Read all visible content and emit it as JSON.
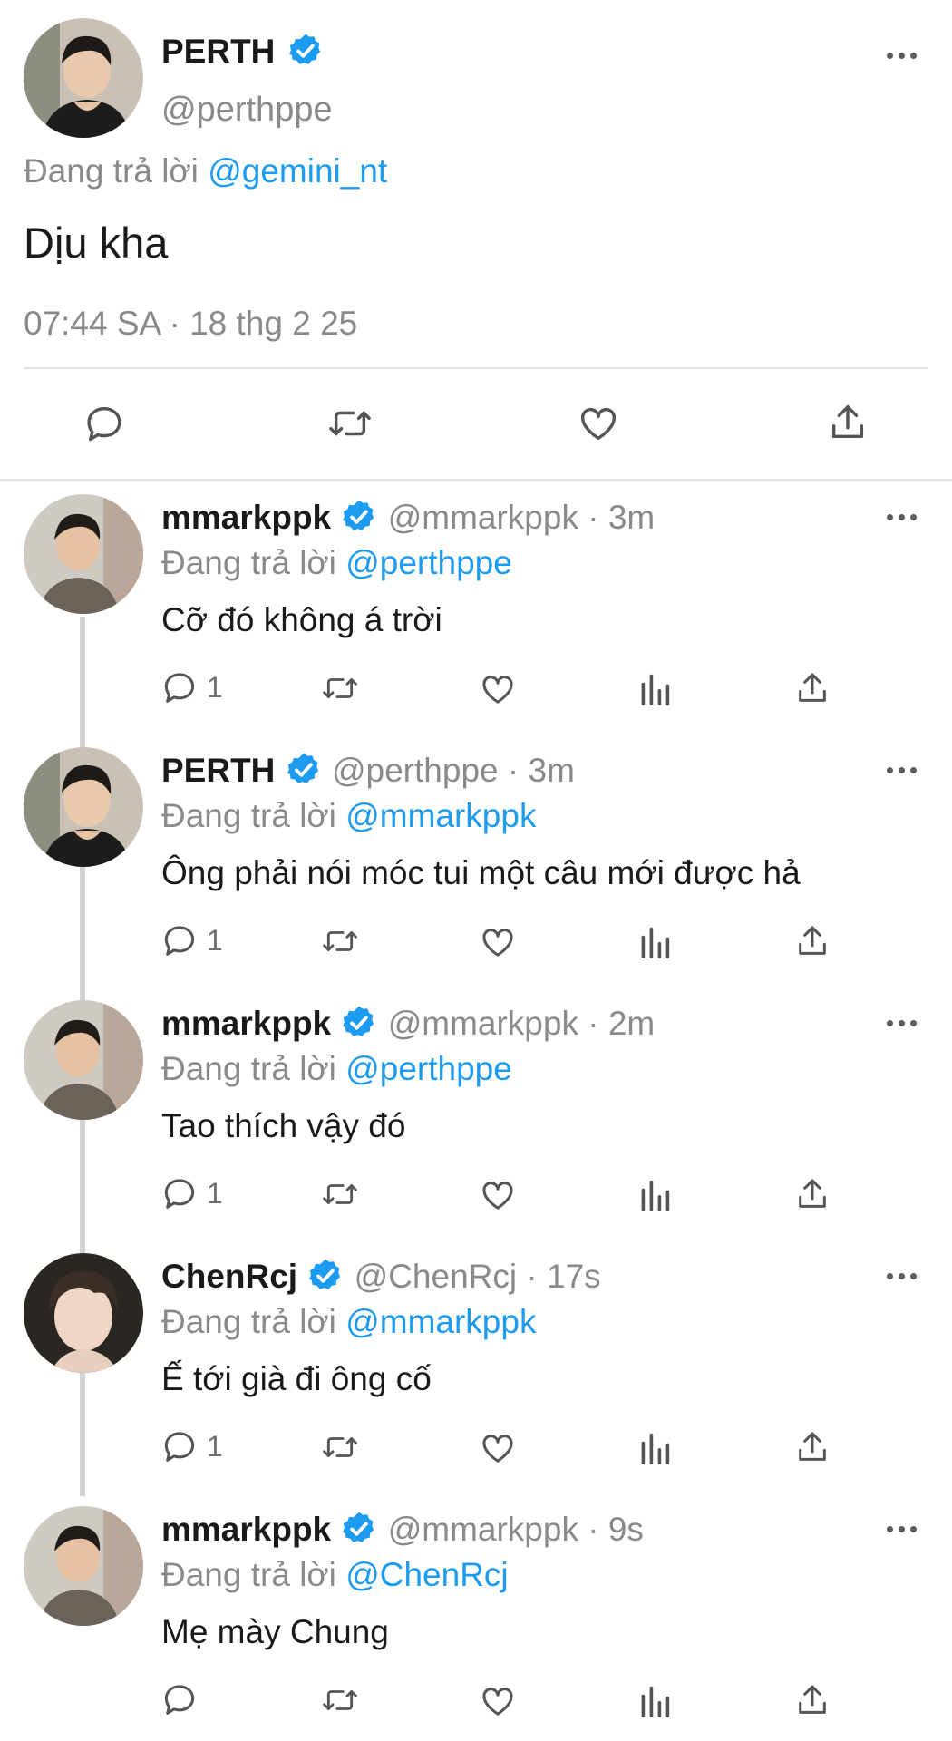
{
  "main_tweet": {
    "name": "PERTH",
    "handle": "@perthppe",
    "reply_prefix": "Đang trả lời",
    "reply_to": "@gemini_nt",
    "text": "Dịu kha",
    "timestamp": "07:44 SA · 18 thg 2 25"
  },
  "replies": [
    {
      "name": "mmarkppk",
      "handle": "@mmarkppk",
      "time": "· 3m",
      "reply_prefix": "Đang trả lời",
      "reply_to": "@perthppe",
      "text": "Cỡ đó không á trời",
      "reply_count": "1"
    },
    {
      "name": "PERTH",
      "handle": "@perthppe",
      "time": "· 3m",
      "reply_prefix": "Đang trả lời",
      "reply_to": "@mmarkppk",
      "text": "Ông phải nói móc tui một câu mới được hả",
      "reply_count": "1"
    },
    {
      "name": "mmarkppk",
      "handle": "@mmarkppk",
      "time": "· 2m",
      "reply_prefix": "Đang trả lời",
      "reply_to": "@perthppe",
      "text": "Tao thích vậy đó",
      "reply_count": "1"
    },
    {
      "name": "ChenRcj",
      "handle": "@ChenRcj",
      "time": "· 17s",
      "reply_prefix": "Đang trả lời",
      "reply_to": "@mmarkppk",
      "text": "Ế tới già đi ông cố",
      "reply_count": "1"
    },
    {
      "name": "mmarkppk",
      "handle": "@mmarkppk",
      "time": "· 9s",
      "reply_prefix": "Đang trả lời",
      "reply_to": "@ChenRcj",
      "text": "Mẹ mày Chung",
      "reply_count": ""
    }
  ],
  "icons": {
    "reply": "reply-icon",
    "retweet": "retweet-icon",
    "like": "like-icon",
    "views": "views-icon",
    "share": "share-icon",
    "verified": "verified-badge-icon",
    "more": "more-icon"
  },
  "colors": {
    "accent": "#1d9bf0",
    "muted": "#8a8a8e",
    "text": "#1a1a1a"
  }
}
